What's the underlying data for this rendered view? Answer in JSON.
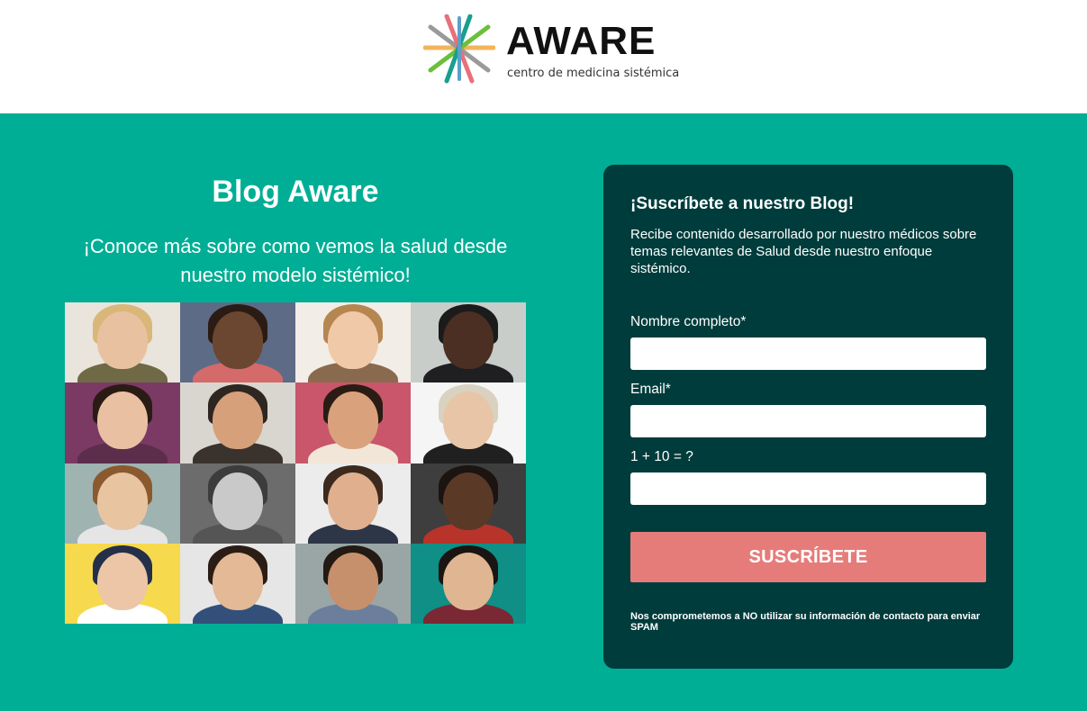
{
  "header": {
    "logo_word": "AWARE",
    "logo_tagline": "centro de medicina sistémica"
  },
  "hero": {
    "title": "Blog Aware",
    "subtitle": "¡Conoce más sobre como vemos la salud desde nuestro modelo sistémico!"
  },
  "photo_grid": {
    "tiles": [
      {
        "bg": "#e9e4dc",
        "skin": "#e8c2a0",
        "hair": "#d9b77a",
        "body": "#6f6a45"
      },
      {
        "bg": "#5d6b86",
        "skin": "#6b4630",
        "hair": "#2a1c14",
        "body": "#d46a6a"
      },
      {
        "bg": "#f2ede6",
        "skin": "#efc9a8",
        "hair": "#b68650",
        "body": "#8a6a4e"
      },
      {
        "bg": "#c9cdc9",
        "skin": "#4a2f22",
        "hair": "#1b1b1b",
        "body": "#1f1f22"
      },
      {
        "bg": "#7a3a64",
        "skin": "#e9c0a2",
        "hair": "#2a1c14",
        "body": "#5c2e4c"
      },
      {
        "bg": "#d9d6cf",
        "skin": "#d5a07a",
        "hair": "#2e2620",
        "body": "#3a332d"
      },
      {
        "bg": "#c9566b",
        "skin": "#d9a27c",
        "hair": "#2a1c14",
        "body": "#f1e6d8"
      },
      {
        "bg": "#f5f5f5",
        "skin": "#e7c5a6",
        "hair": "#d9d2c0",
        "body": "#202020"
      },
      {
        "bg": "#9fb3b1",
        "skin": "#e9c4a0",
        "hair": "#8a5a2e",
        "body": "#e5e5e5"
      },
      {
        "bg": "#6c6c6c",
        "skin": "#c9c9c9",
        "hair": "#3c3c3c",
        "body": "#555555"
      },
      {
        "bg": "#ececec",
        "skin": "#e0b08e",
        "hair": "#3d2a1f",
        "body": "#2d3646"
      },
      {
        "bg": "#3e3e3e",
        "skin": "#5a3a26",
        "hair": "#1c1410",
        "body": "#b8342b"
      },
      {
        "bg": "#f7d94d",
        "skin": "#ecc6a7",
        "hair": "#24304a",
        "body": "#ffffff"
      },
      {
        "bg": "#e6e6e6",
        "skin": "#e3b996",
        "hair": "#2b1d15",
        "body": "#33507a"
      },
      {
        "bg": "#9aa6a6",
        "skin": "#c6906c",
        "hair": "#231a14",
        "body": "#6b7f9c"
      },
      {
        "bg": "#0f8f86",
        "skin": "#e0b592",
        "hair": "#1a1512",
        "body": "#7a2834"
      }
    ]
  },
  "form": {
    "title": "¡Suscríbete a nuestro Blog!",
    "description": "Recibe contenido desarrollado por nuestro médicos sobre temas relevantes de Salud desde nuestro enfoque sistémico.",
    "name_label": "Nombre completo*",
    "name_value": "",
    "email_label": "Email*",
    "email_value": "",
    "captcha_label": "1 + 10 = ?",
    "captcha_value": "",
    "submit_label": "SUSCRÍBETE",
    "spam_note": "Nos comprometemos a NO utilizar su información de contacto para enviar SPAM"
  },
  "colors": {
    "hero_bg": "#00ae95",
    "card_bg": "#003c3c",
    "button_bg": "#e67c7a"
  }
}
